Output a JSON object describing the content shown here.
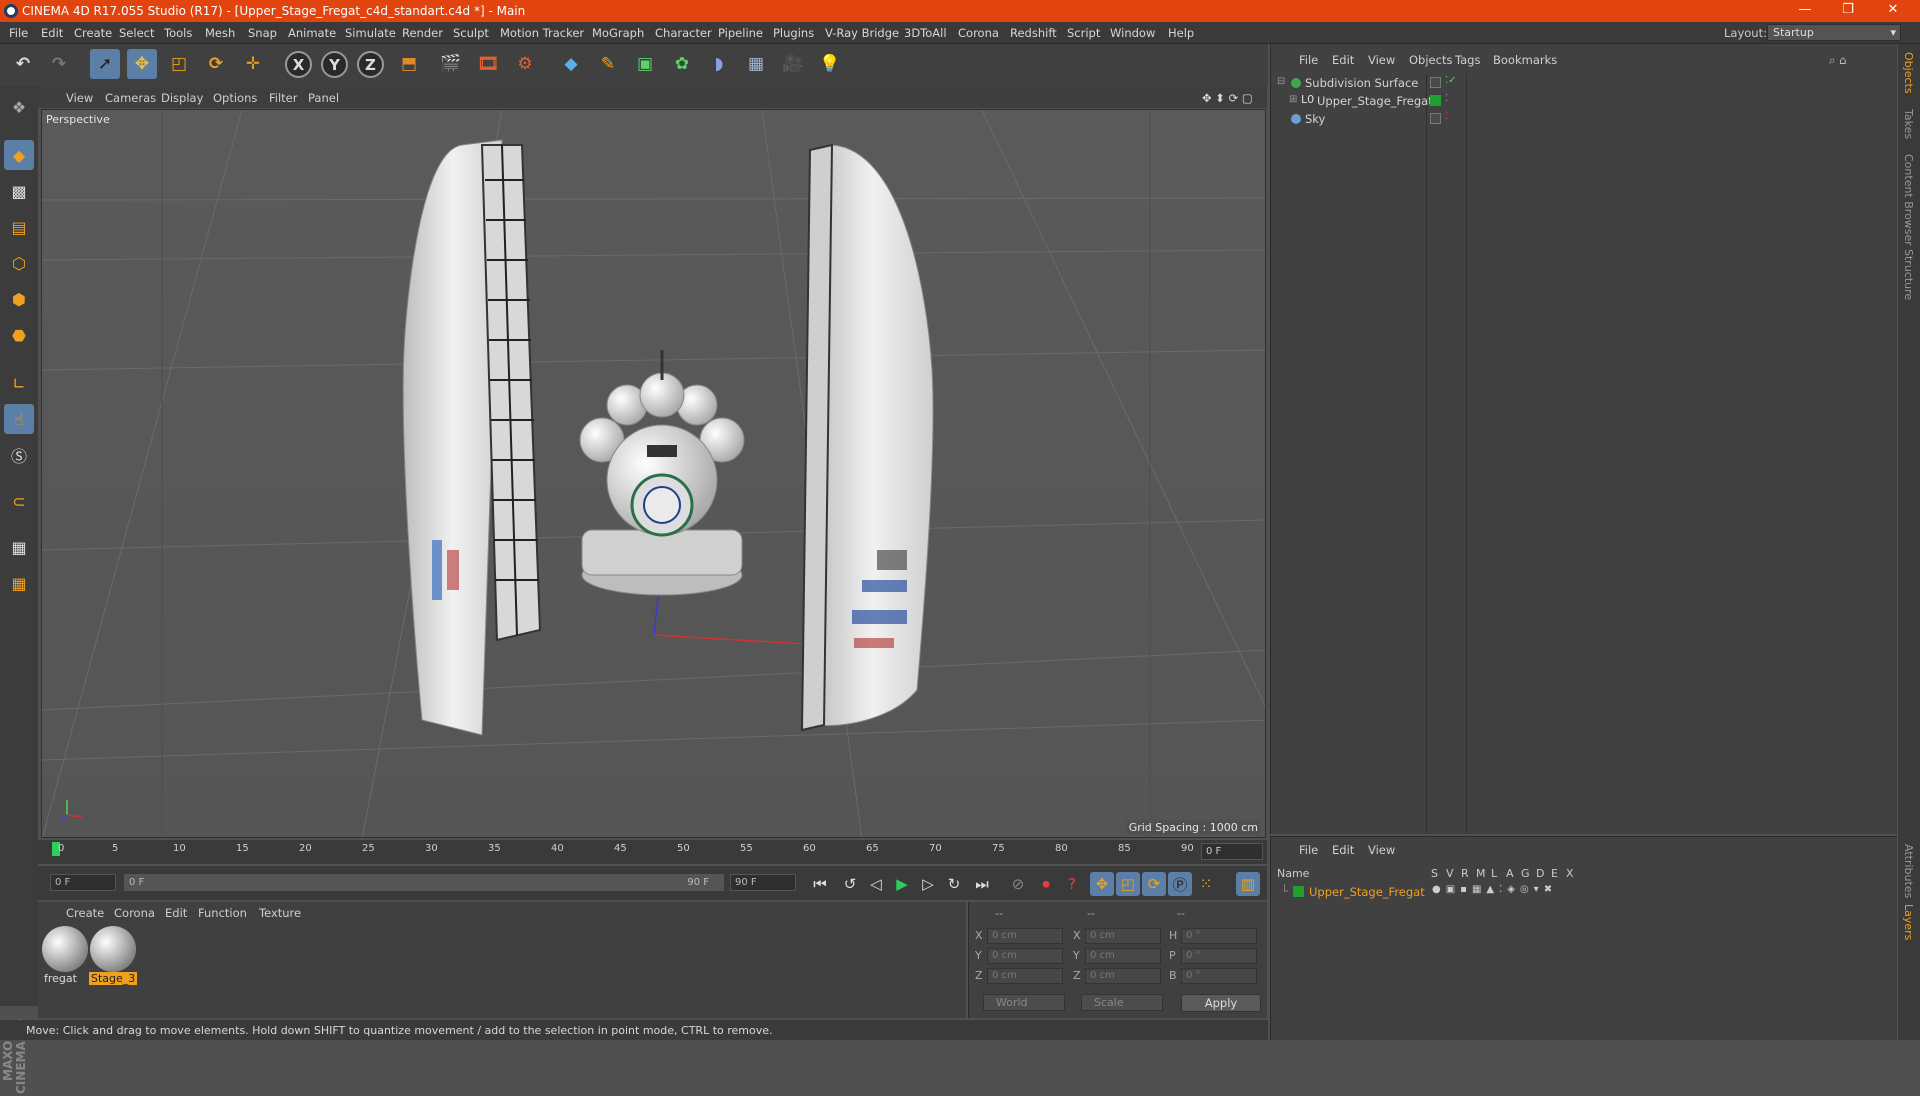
{
  "window": {
    "title": "CINEMA 4D R17.055 Studio (R17) - [Upper_Stage_Fregat_c4d_standart.c4d *] - Main",
    "minimize": "—",
    "restore": "❐",
    "close": "✕"
  },
  "menubar": {
    "items": [
      "File",
      "Edit",
      "Create",
      "Select",
      "Tools",
      "Mesh",
      "Snap",
      "Animate",
      "Simulate",
      "Render",
      "Sculpt",
      "Motion Tracker",
      "MoGraph",
      "Character",
      "Pipeline",
      "Plugins",
      "V-Ray Bridge",
      "3DToAll",
      "Corona",
      "Redshift",
      "Script",
      "Window",
      "Help"
    ],
    "layout_label": "Layout:",
    "layout_value": "Startup"
  },
  "toolbar": {
    "axis_x": "X",
    "axis_y": "Y",
    "axis_z": "Z"
  },
  "viewport": {
    "menu": [
      "View",
      "Cameras",
      "Display",
      "Options",
      "Filter",
      "Panel"
    ],
    "label": "Perspective",
    "grid_spacing": "Grid Spacing : 1000 cm"
  },
  "timeline": {
    "ticks": [
      "0",
      "5",
      "10",
      "15",
      "20",
      "25",
      "30",
      "35",
      "40",
      "45",
      "50",
      "55",
      "60",
      "65",
      "70",
      "75",
      "80",
      "85",
      "90"
    ],
    "current_frame": "0 F",
    "start_frame": "0 F",
    "range_start": "0 F",
    "range_end": "90 F",
    "end_frame": "90 F"
  },
  "materials": {
    "menu": [
      "Create",
      "Corona",
      "Edit",
      "Function",
      "Texture"
    ],
    "items": [
      {
        "name": "fregat",
        "selected": false
      },
      {
        "name": "Stage_3",
        "selected": true
      }
    ]
  },
  "coordinates": {
    "header": [
      "--",
      "--",
      "--"
    ],
    "rows": [
      {
        "a": "X",
        "av": "0 cm",
        "b": "X",
        "bv": "0 cm",
        "c": "H",
        "cv": "0 °"
      },
      {
        "a": "Y",
        "av": "0 cm",
        "b": "Y",
        "bv": "0 cm",
        "c": "P",
        "cv": "0 °"
      },
      {
        "a": "Z",
        "av": "0 cm",
        "b": "Z",
        "bv": "0 cm",
        "c": "B",
        "cv": "0 °"
      }
    ],
    "mode": "World",
    "transform": "Scale",
    "apply": "Apply"
  },
  "status": "Move: Click and drag to move elements. Hold down SHIFT to quantize movement / add to the selection in point mode, CTRL to remove.",
  "object_manager": {
    "menu": [
      "File",
      "Edit",
      "View",
      "Objects",
      "Tags",
      "Bookmarks"
    ],
    "objects": [
      {
        "name": "Subdivision Surface",
        "color": "#3fa84f"
      },
      {
        "name": "Upper_Stage_Fregat",
        "color": "#cfcfcf"
      },
      {
        "name": "Sky",
        "color": "#6a9fd4"
      }
    ]
  },
  "layer_manager": {
    "menu": [
      "File",
      "Edit",
      "View"
    ],
    "columns": [
      "Name",
      "S",
      "V",
      "R",
      "M",
      "L",
      "A",
      "G",
      "D",
      "E",
      "X"
    ],
    "layers": [
      {
        "name": "Upper_Stage_Fregat",
        "color": "#1ea12e"
      }
    ]
  },
  "right_tabs": [
    "Objects",
    "Takes",
    "Content Browser",
    "Structure",
    "Attributes",
    "Layers"
  ],
  "brand": "MAXON CINEMA 4D"
}
